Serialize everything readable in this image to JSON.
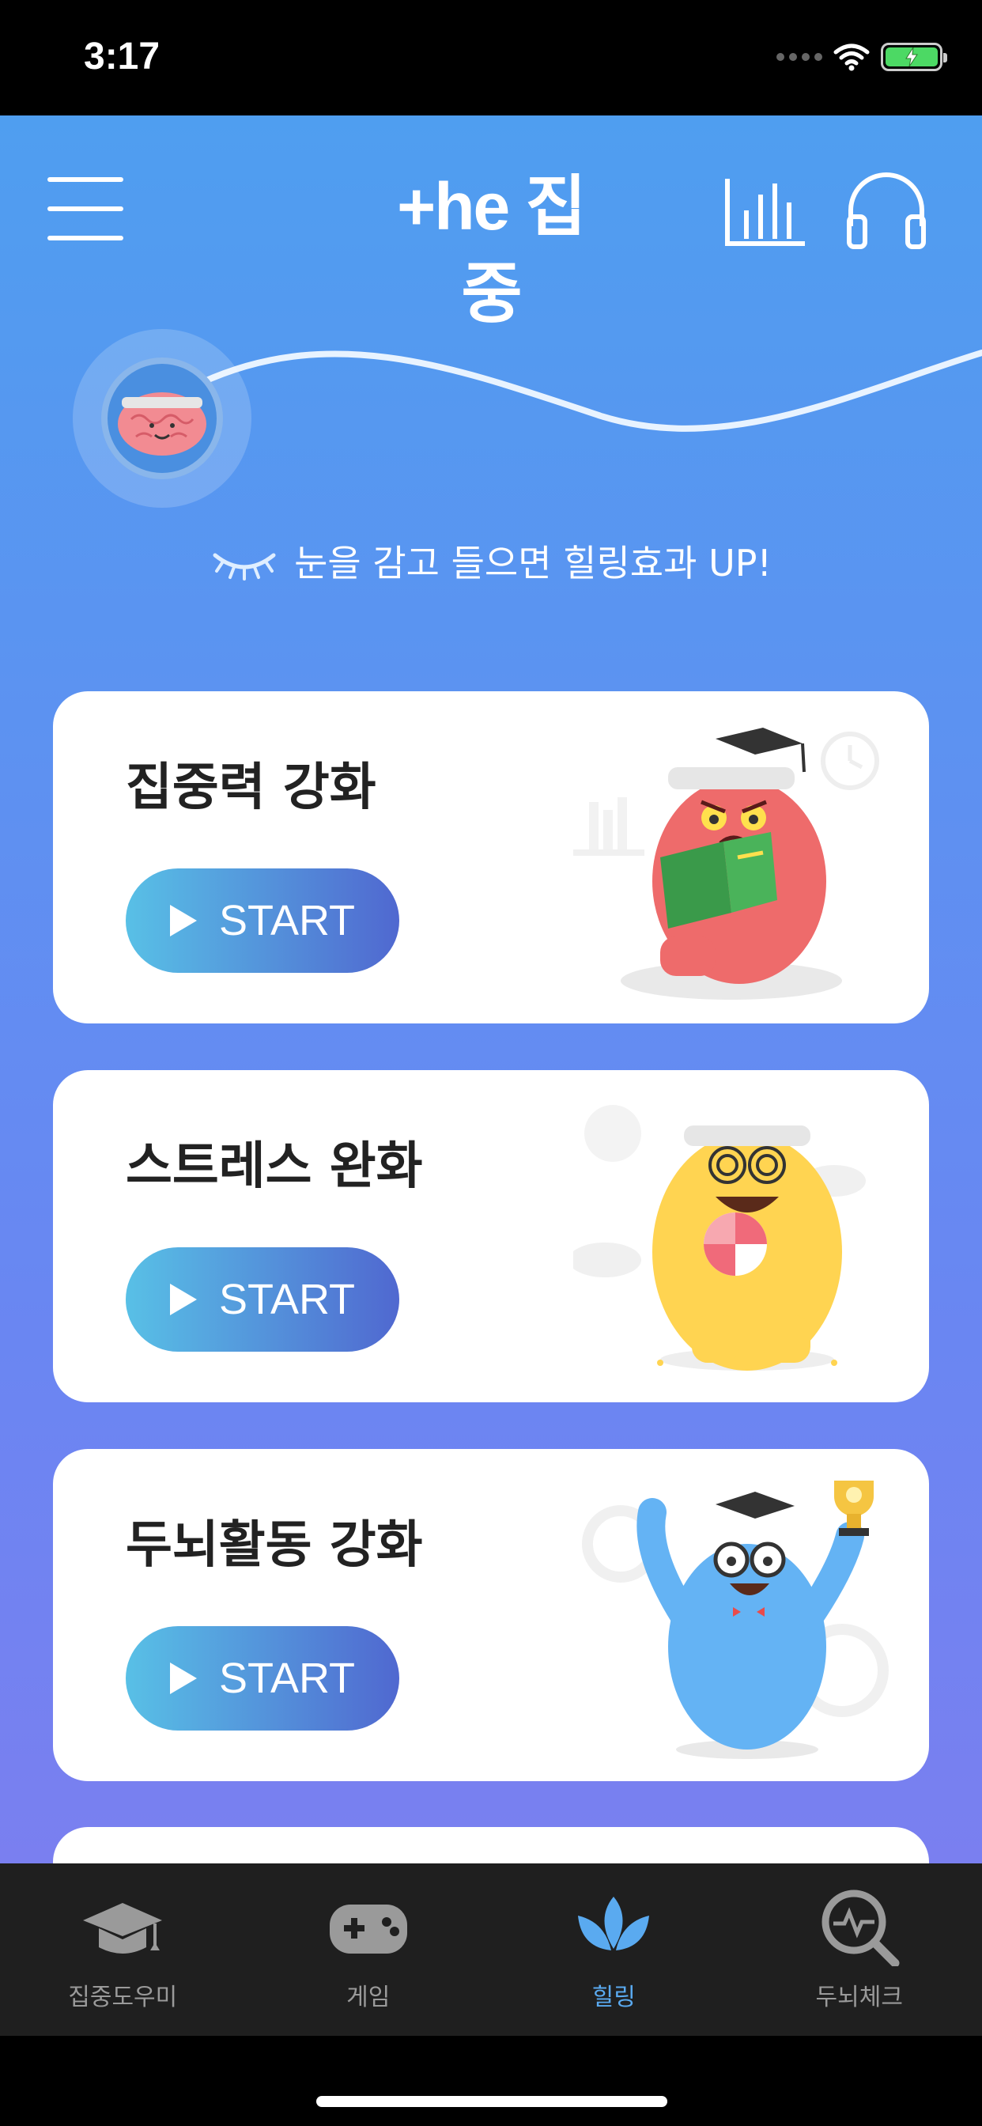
{
  "status_bar": {
    "time": "3:17"
  },
  "header": {
    "logo": "+he 집중",
    "menu_icon": "hamburger-menu-icon",
    "stats_icon": "bar-chart-icon",
    "audio_icon": "headphones-icon"
  },
  "hint": {
    "icon": "closed-eye-icon",
    "text": "눈을 감고 들으면 힐링효과 UP!"
  },
  "cards": [
    {
      "title": "집중력 강화",
      "button": "START",
      "mascot": "red-monster-reading-book"
    },
    {
      "title": "스트레스 완화",
      "button": "START",
      "mascot": "yellow-monster-with-candy"
    },
    {
      "title": "두뇌활동 강화",
      "button": "START",
      "mascot": "blue-monster-with-trophy"
    }
  ],
  "tabs": [
    {
      "label": "집중도우미",
      "icon": "graduation-cap-icon",
      "active": false
    },
    {
      "label": "게임",
      "icon": "gamepad-icon",
      "active": false
    },
    {
      "label": "힐링",
      "icon": "lotus-icon",
      "active": true
    },
    {
      "label": "두뇌체크",
      "icon": "magnifier-pulse-icon",
      "active": false
    }
  ],
  "colors": {
    "bg_top": "#4f9ef0",
    "bg_bottom": "#7a7ff0",
    "button_start": "#58c0e6",
    "button_end": "#5068d0",
    "active_tab": "#5aaaf0",
    "tab_bar": "#1f1f1f"
  }
}
